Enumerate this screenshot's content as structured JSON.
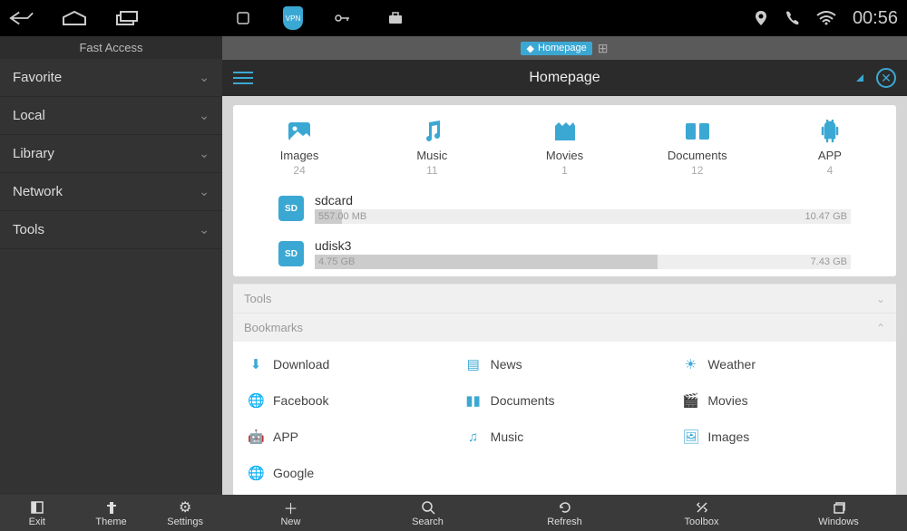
{
  "statusbar": {
    "time": "00:56"
  },
  "sidebar": {
    "title": "Fast Access",
    "items": [
      {
        "label": "Favorite"
      },
      {
        "label": "Local"
      },
      {
        "label": "Library"
      },
      {
        "label": "Network"
      },
      {
        "label": "Tools"
      }
    ]
  },
  "tab": {
    "label": "Homepage"
  },
  "header": {
    "title": "Homepage"
  },
  "categories": [
    {
      "label": "Images",
      "count": "24"
    },
    {
      "label": "Music",
      "count": "11"
    },
    {
      "label": "Movies",
      "count": "1"
    },
    {
      "label": "Documents",
      "count": "12"
    },
    {
      "label": "APP",
      "count": "4"
    }
  ],
  "storage": [
    {
      "name": "sdcard",
      "used": "557.00 MB",
      "total": "10.47 GB",
      "pct": 5
    },
    {
      "name": "udisk3",
      "used": "4.75 GB",
      "total": "7.43 GB",
      "pct": 64
    }
  ],
  "sections": {
    "tools": "Tools",
    "bookmarks": "Bookmarks"
  },
  "bookmarks": [
    {
      "label": "Download"
    },
    {
      "label": "News"
    },
    {
      "label": "Weather"
    },
    {
      "label": "Facebook"
    },
    {
      "label": "Documents"
    },
    {
      "label": "Movies"
    },
    {
      "label": "APP"
    },
    {
      "label": "Music"
    },
    {
      "label": "Images"
    },
    {
      "label": "Google"
    }
  ],
  "bottom": {
    "side": [
      {
        "label": "Exit"
      },
      {
        "label": "Theme"
      },
      {
        "label": "Settings"
      }
    ],
    "main": [
      {
        "label": "New"
      },
      {
        "label": "Search"
      },
      {
        "label": "Refresh"
      },
      {
        "label": "Toolbox"
      },
      {
        "label": "Windows"
      }
    ]
  }
}
